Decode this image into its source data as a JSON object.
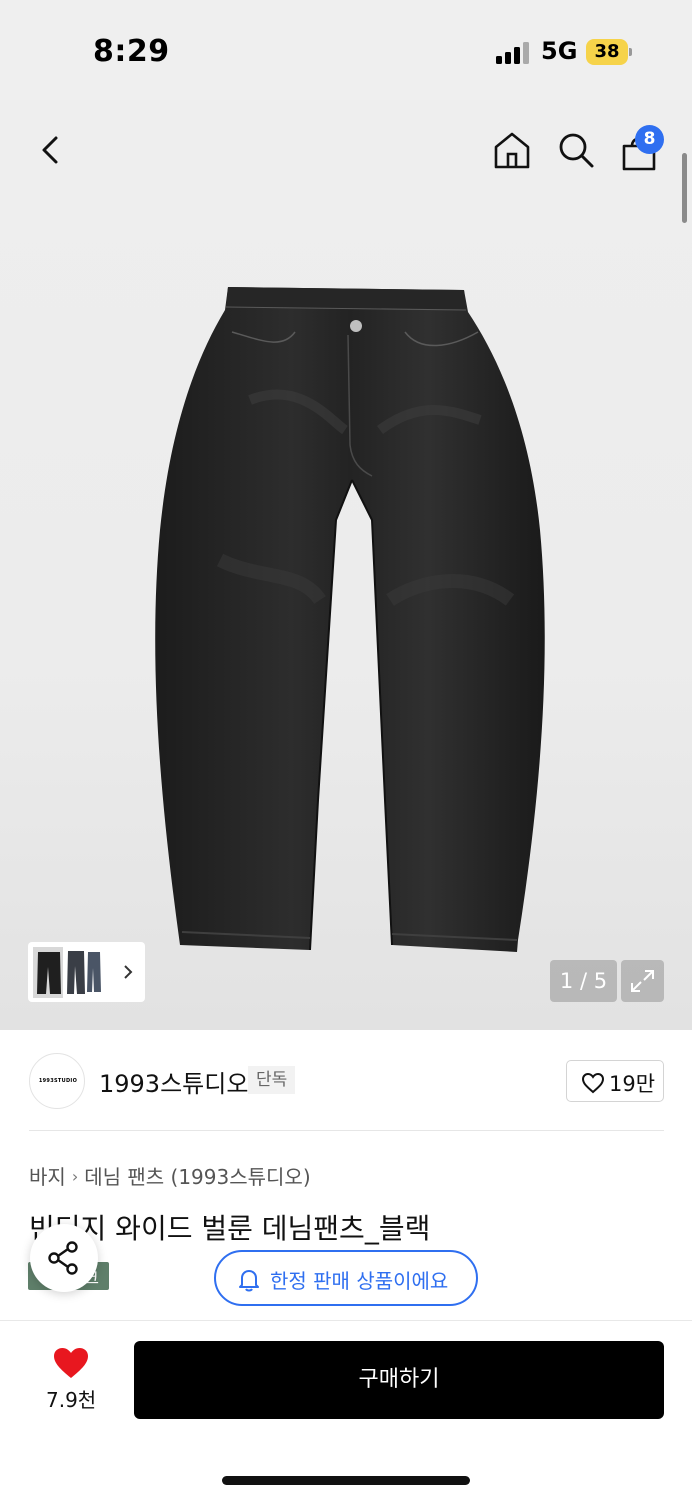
{
  "status_bar": {
    "time": "8:29",
    "network": "5G",
    "battery": "38"
  },
  "header": {
    "bag_count": "8",
    "icons": [
      "back-icon",
      "home-icon",
      "search-icon",
      "bag-icon"
    ]
  },
  "gallery": {
    "counter": "1 / 5",
    "thumbnail_arrow": "›"
  },
  "brand": {
    "logo_text": "1993STUDIO",
    "name": "1993스튜디오",
    "tag": "단독",
    "likes": "19만"
  },
  "breadcrumb": {
    "items": [
      "바지",
      "데님 팬츠 (1993스튜디오)"
    ],
    "separator": "›"
  },
  "product": {
    "title": "빈티지 와이드 벌룬 데님팬츠_블랙",
    "tag_suffix": "크"
  },
  "notice": {
    "label": "한정 판매 상품이에요"
  },
  "bottom_bar": {
    "like_count": "7.9천",
    "buy_label": "구매하기"
  },
  "colors": {
    "accent_blue": "#2f6ff0",
    "heart_red": "#e8171f",
    "tag_green": "#5f7f6a"
  }
}
